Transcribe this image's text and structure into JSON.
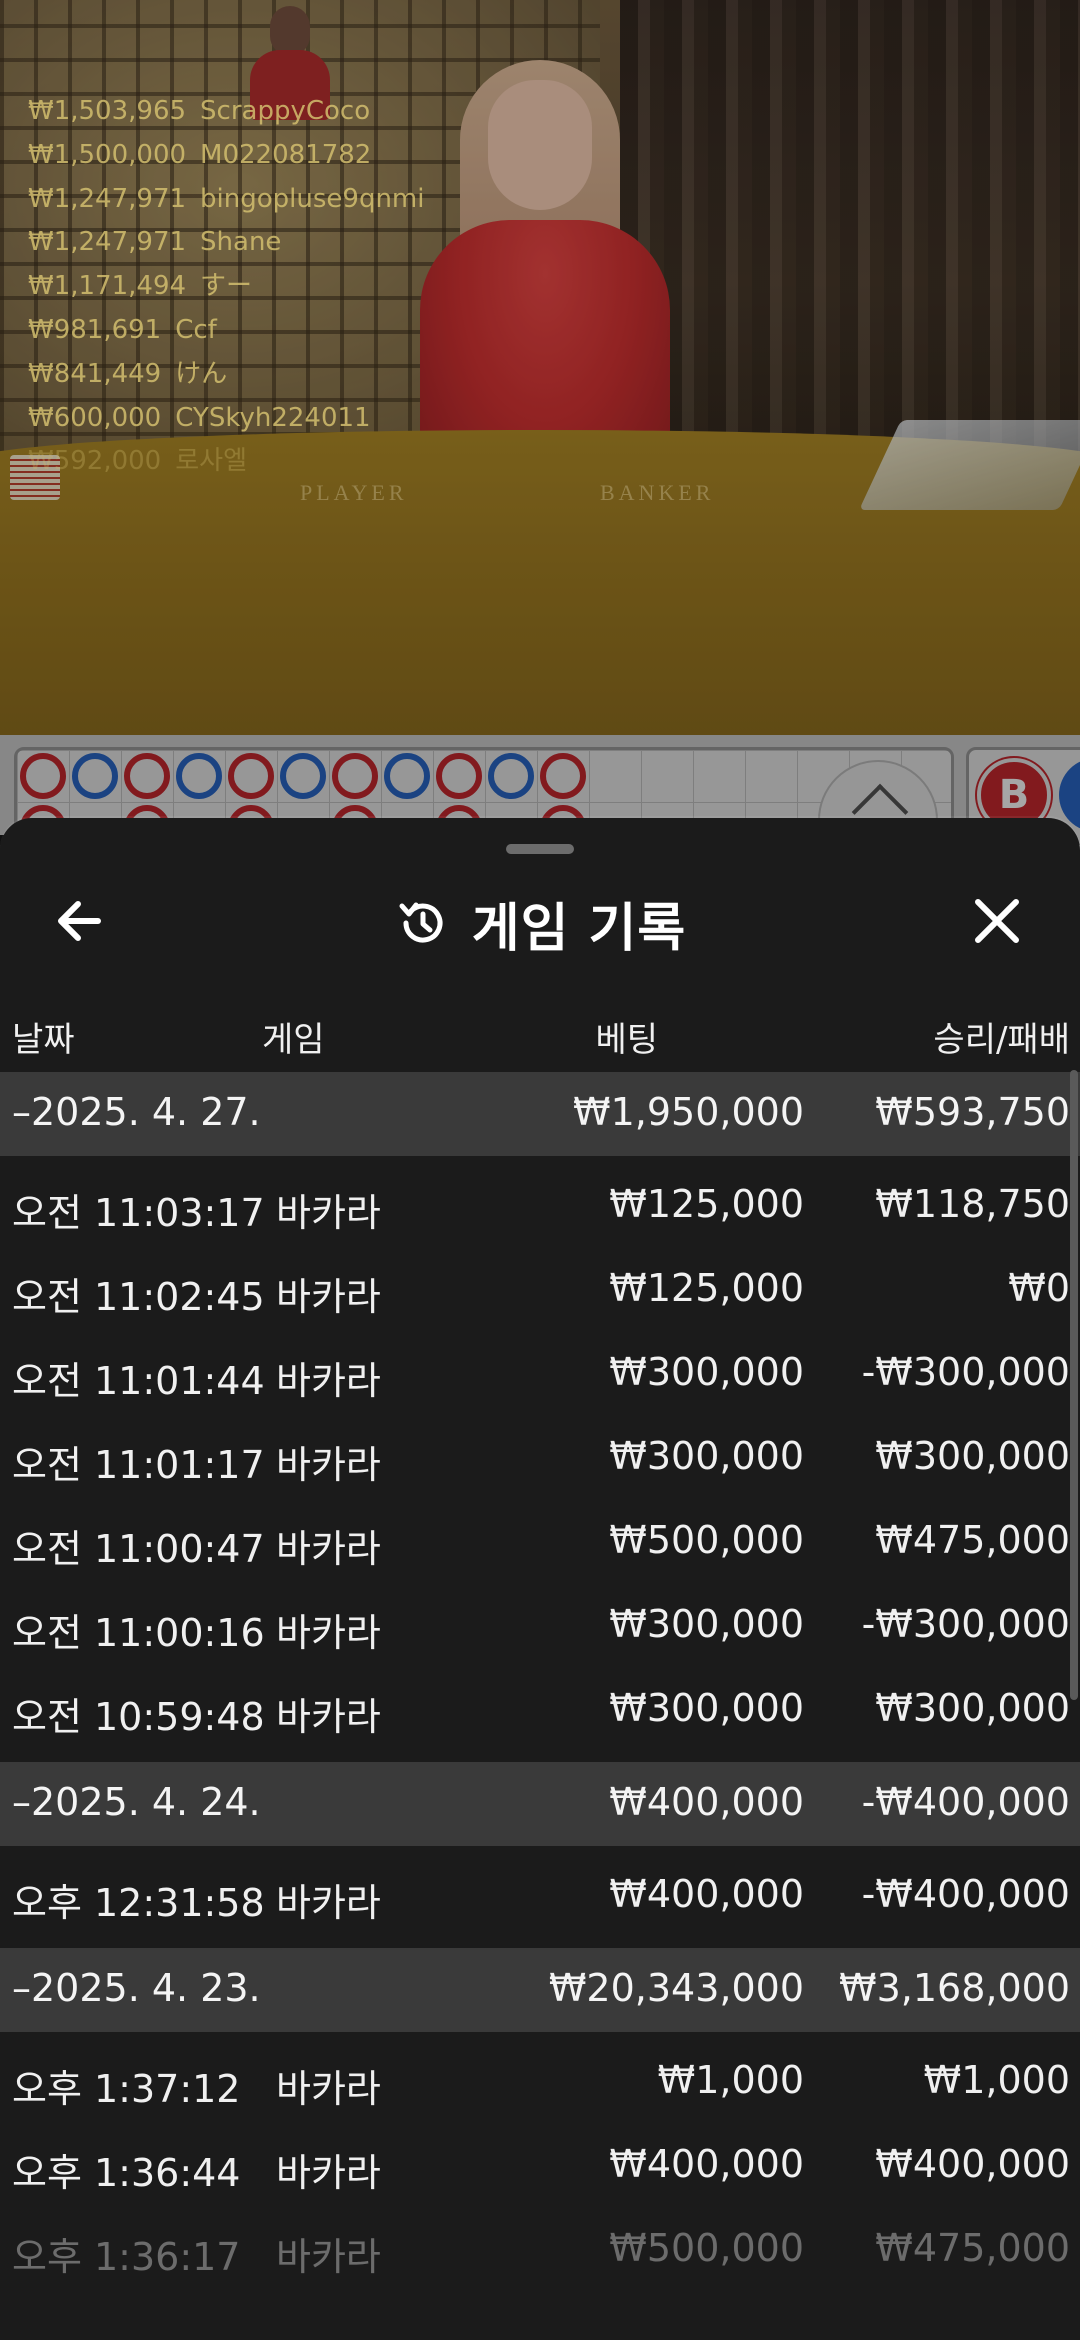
{
  "video": {
    "table_labels": {
      "player": "PLAYER",
      "banker": "BANKER"
    },
    "leaderboard": [
      {
        "amount": "₩1,503,965",
        "name": "ScrappyCoco"
      },
      {
        "amount": "₩1,500,000",
        "name": "M022081782"
      },
      {
        "amount": "₩1,247,971",
        "name": "bingopluse9qnmi"
      },
      {
        "amount": "₩1,247,971",
        "name": "Shane"
      },
      {
        "amount": "₩1,171,494",
        "name": "すー"
      },
      {
        "amount": "₩981,691",
        "name": "Ccf"
      },
      {
        "amount": "₩841,449",
        "name": "けん"
      },
      {
        "amount": "₩600,000",
        "name": "CYSkyh224011"
      },
      {
        "amount": "₩592,000",
        "name": "로사엘"
      }
    ]
  },
  "roadmap": {
    "banker_badge": "B",
    "beads": [
      "red",
      "blue",
      "red",
      "blue",
      "red",
      "blue",
      "red",
      "blue",
      "red",
      "blue",
      "red"
    ]
  },
  "sheet": {
    "title": "게임 기록",
    "icons": {
      "back": "arrow-left-icon",
      "history": "history-clock-icon",
      "close": "close-icon"
    },
    "columns": {
      "date": "날짜",
      "game": "게임",
      "bet": "베팅",
      "result": "승리/패배"
    },
    "groups": [
      {
        "date": "–2025. 4. 27.",
        "bet": "₩1,950,000",
        "result": "₩593,750",
        "rows": [
          {
            "time": "오전 11:03:17",
            "game": "바카라",
            "bet": "₩125,000",
            "result": "₩118,750"
          },
          {
            "time": "오전 11:02:45",
            "game": "바카라",
            "bet": "₩125,000",
            "result": "₩0"
          },
          {
            "time": "오전 11:01:44",
            "game": "바카라",
            "bet": "₩300,000",
            "result": "-₩300,000"
          },
          {
            "time": "오전 11:01:17",
            "game": "바카라",
            "bet": "₩300,000",
            "result": "₩300,000"
          },
          {
            "time": "오전 11:00:47",
            "game": "바카라",
            "bet": "₩500,000",
            "result": "₩475,000"
          },
          {
            "time": "오전 11:00:16",
            "game": "바카라",
            "bet": "₩300,000",
            "result": "-₩300,000"
          },
          {
            "time": "오전 10:59:48",
            "game": "바카라",
            "bet": "₩300,000",
            "result": "₩300,000"
          }
        ]
      },
      {
        "date": "–2025. 4. 24.",
        "bet": "₩400,000",
        "result": "-₩400,000",
        "rows": [
          {
            "time": "오후 12:31:58",
            "game": "바카라",
            "bet": "₩400,000",
            "result": "-₩400,000"
          }
        ]
      },
      {
        "date": "–2025. 4. 23.",
        "bet": "₩20,343,000",
        "result": "₩3,168,000",
        "rows": [
          {
            "time": "오후 1:37:12",
            "game": "바카라",
            "bet": "₩1,000",
            "result": "₩1,000"
          },
          {
            "time": "오후 1:36:44",
            "game": "바카라",
            "bet": "₩400,000",
            "result": "₩400,000"
          },
          {
            "time": "오후 1:36:17",
            "game": "바카라",
            "bet": "₩500,000",
            "result": "₩475,000"
          }
        ]
      }
    ]
  }
}
